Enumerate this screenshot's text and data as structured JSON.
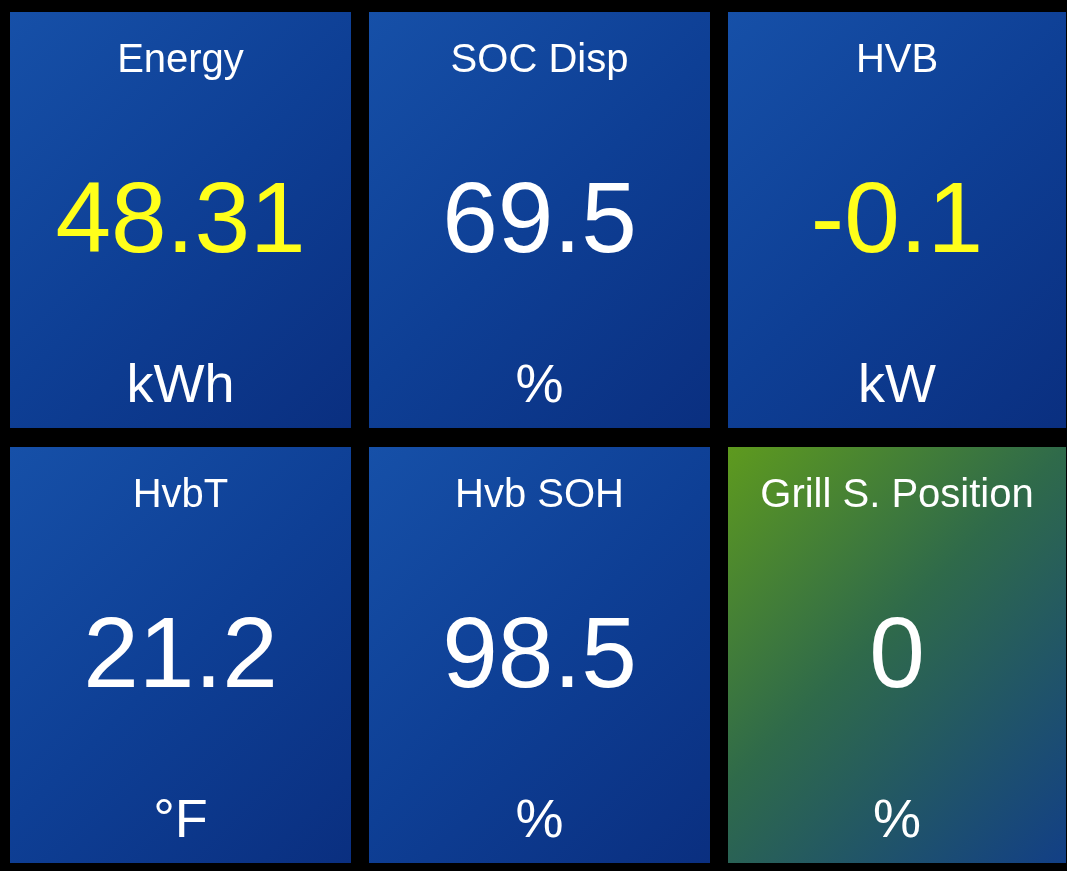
{
  "tiles": [
    {
      "title": "Energy",
      "value": "48.31",
      "unit": "kWh",
      "color": "#ffff1a",
      "kind": "normal"
    },
    {
      "title": "SOC Disp",
      "value": "69.5",
      "unit": "%",
      "color": "#ffffff",
      "kind": "normal"
    },
    {
      "title": "HVB",
      "value": "-0.1",
      "unit": "kW",
      "color": "#ffff1a",
      "kind": "normal"
    },
    {
      "title": "HvbT",
      "value": "21.2",
      "unit": "°F",
      "color": "#ffffff",
      "kind": "normal"
    },
    {
      "title": "Hvb SOH",
      "value": "98.5",
      "unit": "%",
      "color": "#ffffff",
      "kind": "normal"
    },
    {
      "title": "Grill S. Position",
      "value": "0",
      "unit": "%",
      "color": "#ffffff",
      "kind": "warning"
    }
  ]
}
